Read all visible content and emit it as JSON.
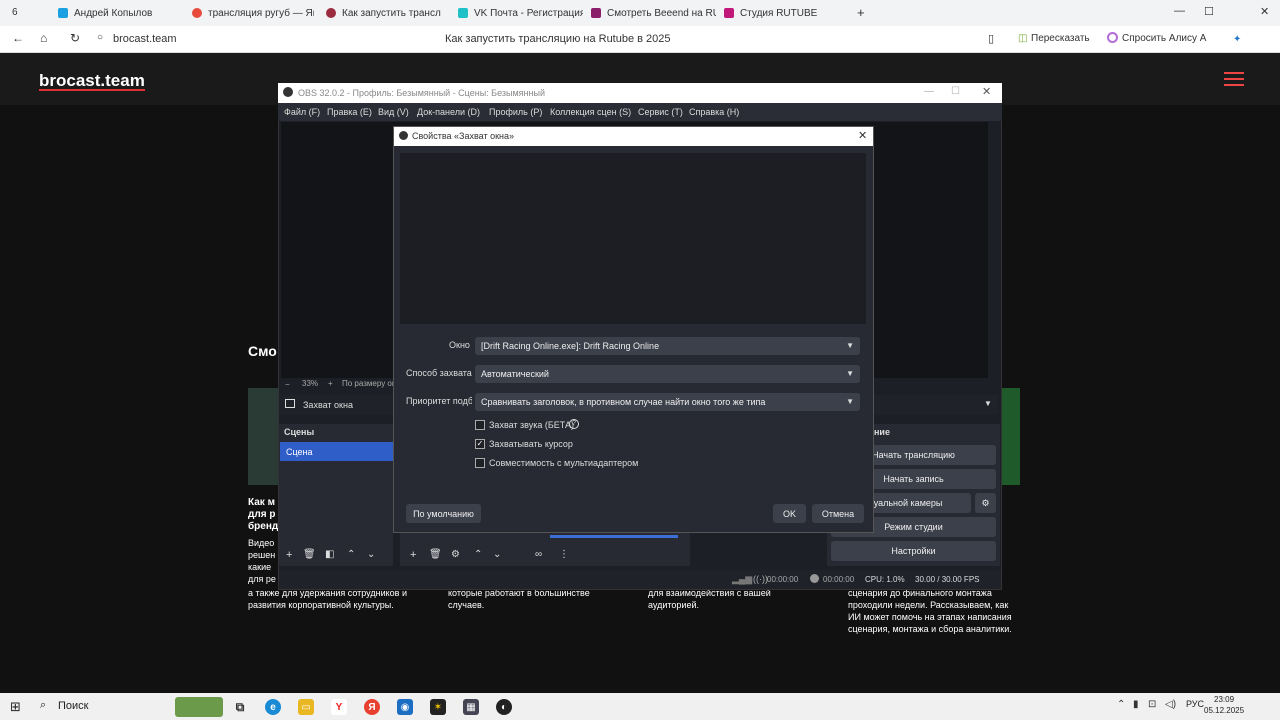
{
  "browser": {
    "tabs": [
      {
        "label": "Андрей Копылов",
        "color": "#1ba1e2"
      },
      {
        "label": "трансляция ругуб — Ян",
        "color": "#e84b3c"
      },
      {
        "label": "Как запустить трансл",
        "color": "#9b2b3e"
      },
      {
        "label": "VK Почта - Регистрация",
        "color": "#1fc1c7"
      },
      {
        "label": "Смотреть Веееnd на RU",
        "color": "#8a1e6b"
      },
      {
        "label": "Студия RUTUBE",
        "color": "#c0197a"
      }
    ],
    "tab_count_left": "6",
    "new_tab": "+",
    "url": "brocast.team",
    "page_title": "Как запустить трансляцию на Rutube в 2025",
    "share_label": "Пересказать",
    "alice_label": "Спросить Алису А"
  },
  "site": {
    "logo": "brocast.team",
    "heading_fragment": "Смо",
    "left_col": [
      "Как м",
      "для р",
      "бренд",
      "Видео",
      "решен",
      "какие",
      "для ре",
      "а также для удержания сотрудников и",
      "развития корпоративной культуры."
    ],
    "mid_col": [
      "которые работают в большинстве",
      "случаев."
    ],
    "right_mid_col": [
      "для взаимодействия с вашей",
      "аудиторией."
    ],
    "right_col": [
      "сценария до финального монтажа",
      "проходили недели. Рассказываем, как",
      "ИИ может помочь на этапах написания",
      "сценария, монтажа и сбора аналитики."
    ]
  },
  "obs": {
    "title": "OBS 32.0.2 - Профиль: Безымянный - Сцены: Безымянный",
    "menu": [
      "Файл (F)",
      "Правка (E)",
      "Вид (V)",
      "Док-панели (D)",
      "Профиль (P)",
      "Коллекция сцен (S)",
      "Сервис (T)",
      "Справка (H)"
    ],
    "zoom": "33%",
    "zoom_fit": "По размеру ок",
    "source_name": "Захват окна",
    "scenes_title": "Сцены",
    "scene_item": "Сцена",
    "controls_title": "ние",
    "controls": [
      "Начать трансляцию",
      "Начать запись",
      "иртуальной камеры",
      "Режим студии",
      "Настройки"
    ],
    "status": {
      "stream_time": "00:00:00",
      "rec_time": "00:00:00",
      "cpu": "CPU: 1.0%",
      "fps": "30.00 / 30.00 FPS"
    }
  },
  "dialog": {
    "title": "Свойства «Захват окна»",
    "fields": [
      {
        "label": "Окно",
        "value": "[Drift Racing Online.exe]: Drift Racing Online"
      },
      {
        "label": "Способ захвата",
        "value": "Автоматический"
      },
      {
        "label": "Приоритет подб",
        "value": "Сравнивать заголовок, в противном случае найти окно того же типа"
      }
    ],
    "checkboxes": [
      {
        "label": "Захват звука (БЕТА)",
        "checked": false
      },
      {
        "label": "Захватывать курсор",
        "checked": true
      },
      {
        "label": "Совместимость с мультиадаптером",
        "checked": false
      }
    ],
    "defaults_button": "По умолчанию",
    "ok_button": "OK",
    "cancel_button": "Отмена"
  },
  "taskbar": {
    "search": "Поиск",
    "lang": "РУС",
    "time": "23:09",
    "date": "05.12.2025"
  }
}
